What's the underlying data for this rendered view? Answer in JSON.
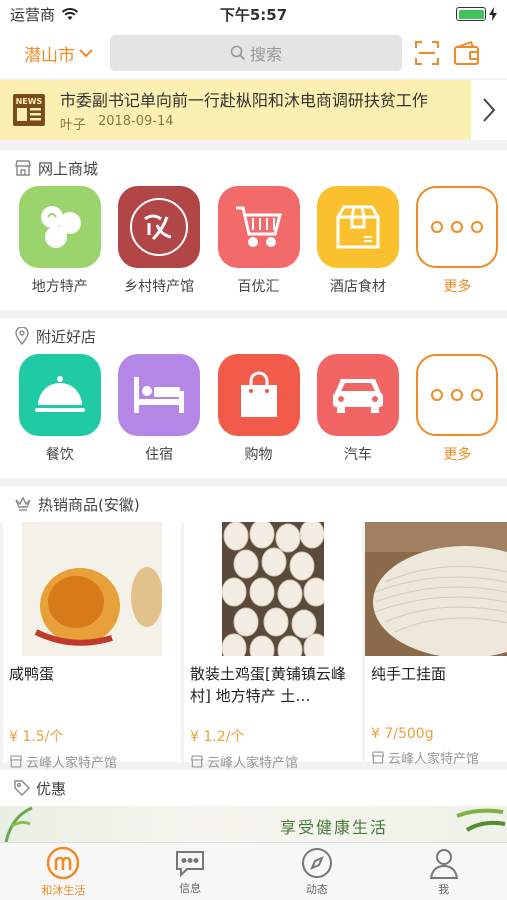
{
  "status": {
    "carrier": "运营商",
    "time": "下午5:57",
    "battery_level": 1.0
  },
  "header": {
    "city": "潜山市",
    "search_placeholder": "搜索"
  },
  "news": {
    "title": "市委副书记单向前一行赴枞阳和沐电商调研扶贫工作",
    "author": "叶子",
    "date": "2018-09-14"
  },
  "mall": {
    "title": "网上商城",
    "items": [
      {
        "label": "地方特产"
      },
      {
        "label": "乡村特产馆"
      },
      {
        "label": "百优汇"
      },
      {
        "label": "酒店食材"
      },
      {
        "label": "更多"
      }
    ]
  },
  "nearby": {
    "title": "附近好店",
    "items": [
      {
        "label": "餐饮"
      },
      {
        "label": "住宿"
      },
      {
        "label": "购物"
      },
      {
        "label": "汽车"
      },
      {
        "label": "更多"
      }
    ]
  },
  "hot": {
    "title": "热销商品(安徽)",
    "products": [
      {
        "name": "咸鸭蛋",
        "price": "¥ 1.5/个",
        "shop": "云峰人家特产馆"
      },
      {
        "name": "散装土鸡蛋[黄铺镇云峰村] 地方特产 土…",
        "price": "¥ 1.2/个",
        "shop": "云峰人家特产馆"
      },
      {
        "name": "纯手工挂面",
        "price": "¥ 7/500g",
        "shop": "云峰人家特产馆"
      }
    ]
  },
  "promo": {
    "title": "优惠",
    "banner_text": "享受健康生活"
  },
  "tabbar": [
    {
      "label": "和沐生活",
      "active": true
    },
    {
      "label": "信息"
    },
    {
      "label": "动态"
    },
    {
      "label": "我"
    }
  ],
  "colors": {
    "accent": "#f08a24",
    "news_bg": "#fbefb2",
    "price": "#e8a23a"
  }
}
